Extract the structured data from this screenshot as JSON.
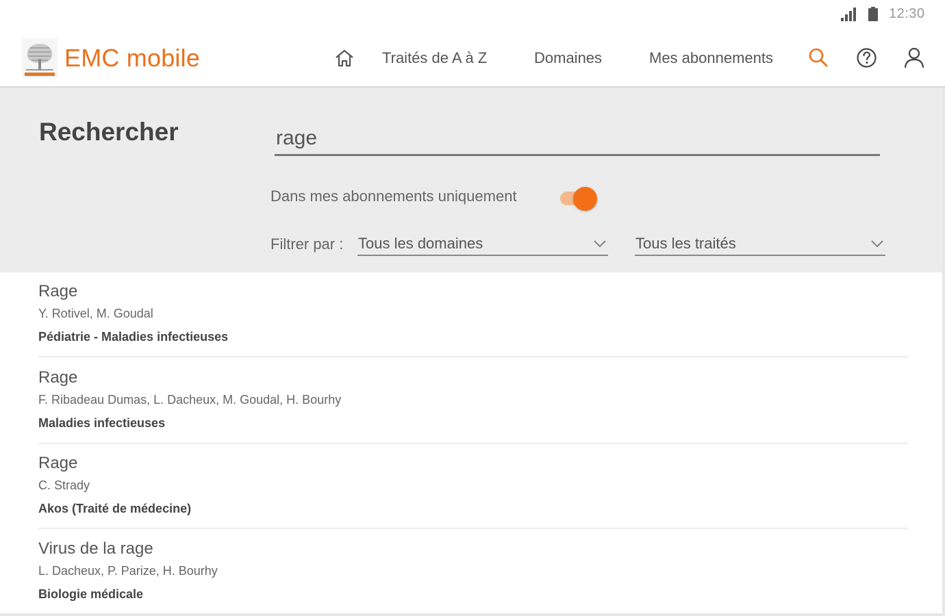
{
  "status_bar": {
    "time": "12:30"
  },
  "header": {
    "brand": "EMC mobile",
    "nav": {
      "traites": "Traités de A à Z",
      "domaines": "Domaines",
      "abonnements": "Mes abonnements"
    }
  },
  "search": {
    "title": "Rechercher",
    "query": "rage",
    "toggle_label": "Dans mes abonnements uniquement",
    "toggle_on": true,
    "filter_label": "Filtrer par :",
    "domain_filter": "Tous les domaines",
    "traite_filter": "Tous les traités"
  },
  "results": [
    {
      "title": "Rage",
      "authors": "Y. Rotivel, M. Goudal",
      "domain": "Pédiatrie - Maladies infectieuses"
    },
    {
      "title": "Rage",
      "authors": "F. Ribadeau Dumas, L. Dacheux, M. Goudal, H. Bourhy",
      "domain": "Maladies infectieuses"
    },
    {
      "title": "Rage",
      "authors": "C. Strady",
      "domain": "Akos (Traité de médecine)"
    },
    {
      "title": "Virus de la rage",
      "authors": "L. Dacheux, P. Parize, H. Bourhy",
      "domain": "Biologie médicale"
    }
  ],
  "colors": {
    "accent": "#e9711c",
    "toggle_knob": "#f36f17",
    "toggle_track": "#f4b88c",
    "panel_bg": "#ececec"
  },
  "icons": [
    "signal-icon",
    "battery-icon",
    "elsevier-tree-logo",
    "home-icon",
    "search-icon",
    "help-icon",
    "user-icon",
    "chevron-down-icon"
  ]
}
